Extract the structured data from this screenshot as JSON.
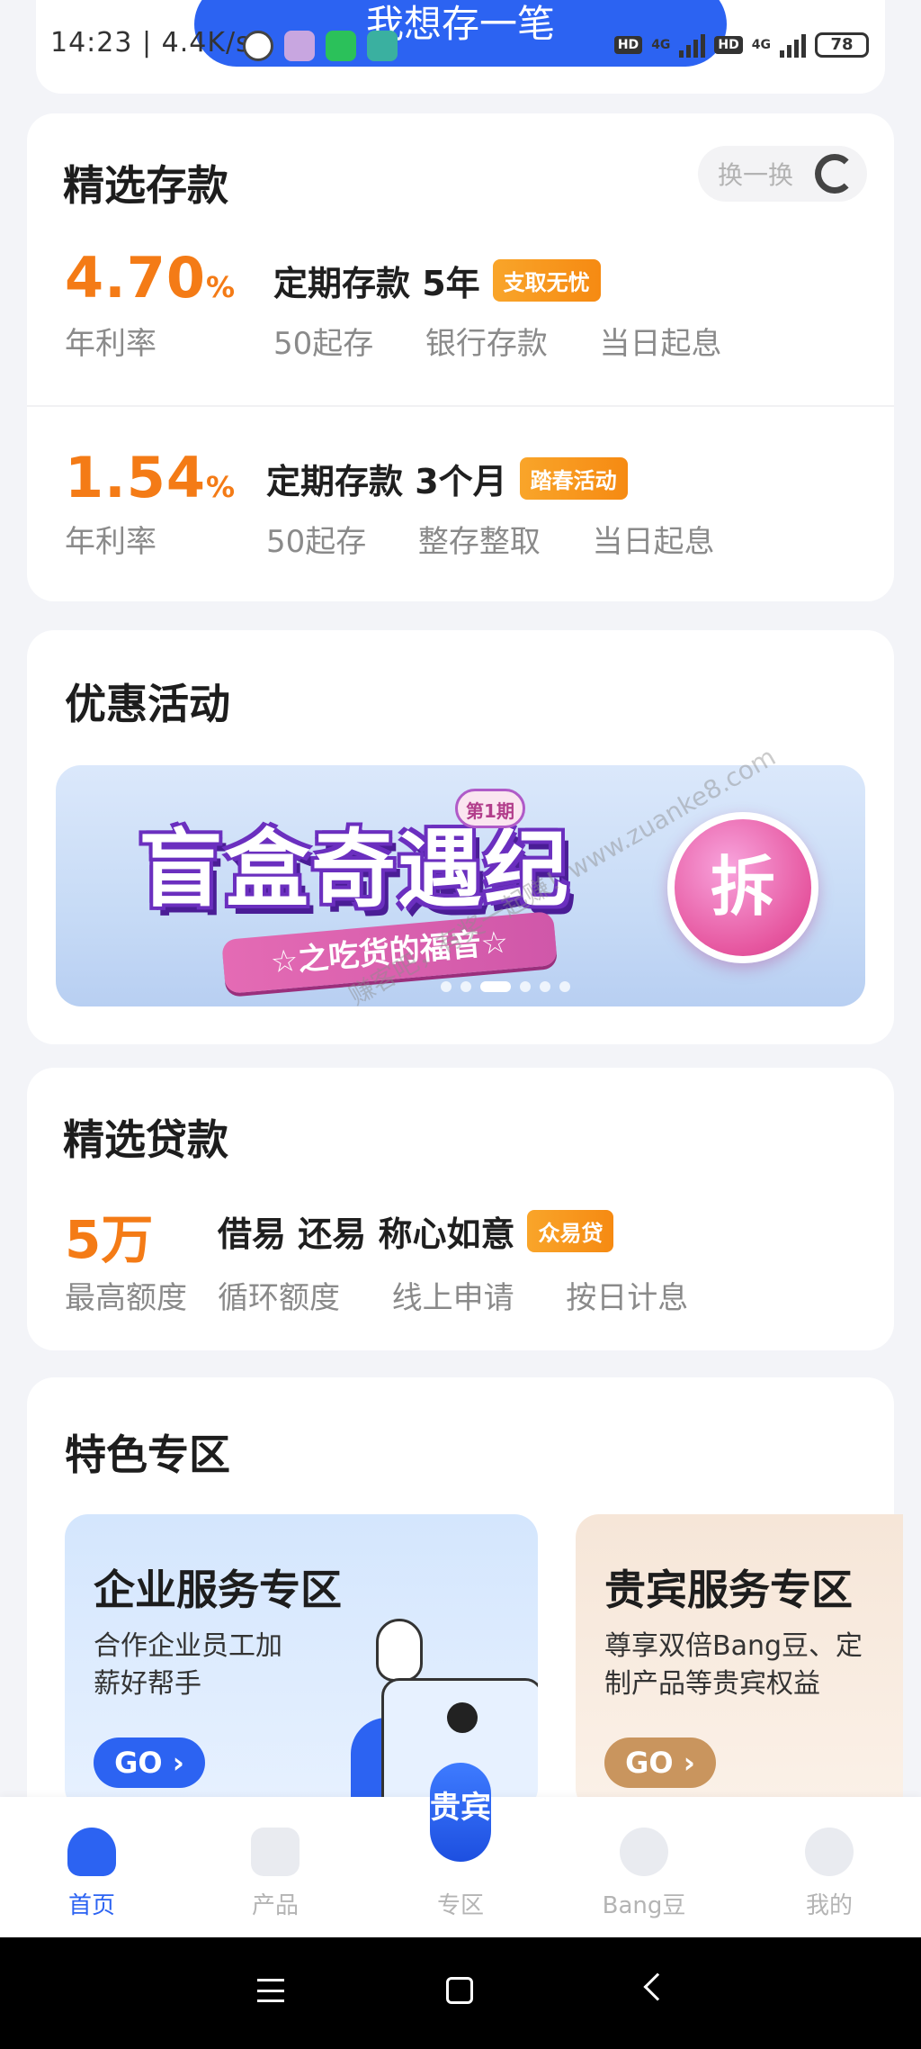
{
  "status_bar": {
    "time": "14:23",
    "speed": "4.4K/s",
    "network_1": "4G",
    "network_2": "4G",
    "battery": "78",
    "hd_label": "HD"
  },
  "top_cta": {
    "label": "我想存一笔"
  },
  "deposits": {
    "title": "精选存款",
    "refresh_label": "换一换",
    "items": [
      {
        "rate": "4.70",
        "rate_unit": "%",
        "rate_label": "年利率",
        "name": "定期存款 5年",
        "tag": "支取无忧",
        "features": "50起存  银行存款  当日起息"
      },
      {
        "rate": "1.54",
        "rate_unit": "%",
        "rate_label": "年利率",
        "name": "定期存款 3个月",
        "tag": "踏春活动",
        "features": "50起存  整存整取  当日起息"
      }
    ]
  },
  "promotions": {
    "title": "优惠活动",
    "banner": {
      "issue": "第1期",
      "headline": "盲盒奇遇纪",
      "ribbon": "☆之吃货的福音☆",
      "button": "拆"
    },
    "watermark": "赚客吧，有奖一起赚！www.zuanke8.com"
  },
  "loans": {
    "title": "精选贷款",
    "amount": "5万",
    "amount_label": "最高额度",
    "name": "借易 还易 称心如意",
    "tag": "众易贷",
    "features": "循环额度  线上申请  按日计息"
  },
  "features": {
    "title": "特色专区",
    "zones": [
      {
        "title": "企业服务专区",
        "desc": "合作企业员工加薪好帮手",
        "go": "GO ›"
      },
      {
        "title": "贵宾服务专区",
        "desc": "尊享双倍Bang豆、定制产品等贵宾权益",
        "go": "GO ›"
      }
    ]
  },
  "tabbar": {
    "center_badge": "贵宾",
    "tabs": [
      {
        "label": "首页",
        "icon": "home-icon",
        "active": true
      },
      {
        "label": "产品",
        "icon": "product-icon",
        "active": false
      },
      {
        "label": "专区",
        "icon": "zone-icon",
        "active": false
      },
      {
        "label": "Bang豆",
        "icon": "bean-icon",
        "active": false
      },
      {
        "label": "我的",
        "icon": "profile-icon",
        "active": false
      }
    ]
  },
  "colors": {
    "accent": "#2c63f2",
    "rate": "#f47b16",
    "tag": "#f68a12"
  }
}
